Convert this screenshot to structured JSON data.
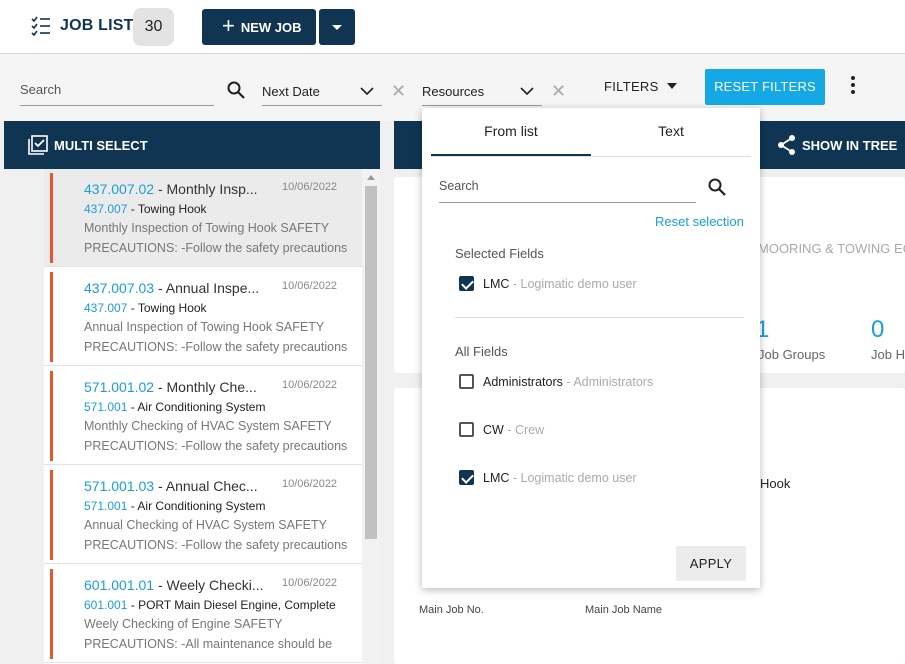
{
  "header": {
    "title": "JOB LIST",
    "count": "30",
    "new_job_label": "NEW JOB"
  },
  "filters": {
    "search_placeholder": "Search",
    "date_select": "Next Date",
    "resources_select": "Resources",
    "filters_label": "FILTERS",
    "reset_label": "RESET FILTERS"
  },
  "left_panel": {
    "multi_select_label": "MULTI SELECT",
    "jobs": [
      {
        "code": "437.007.02",
        "name": "- Monthly Insp...",
        "date": "10/06/2022",
        "parent_code": "437.007",
        "parent_name": "- Towing Hook",
        "desc1": "Monthly Inspection of Towing Hook SAFETY",
        "desc2": "PRECAUTIONS: -Follow the safety precautions"
      },
      {
        "code": "437.007.03",
        "name": "- Annual Inspe...",
        "date": "10/06/2022",
        "parent_code": "437.007",
        "parent_name": "- Towing Hook",
        "desc1": "Annual Inspection of Towing Hook SAFETY",
        "desc2": "PRECAUTIONS: -Follow the safety precautions"
      },
      {
        "code": "571.001.02",
        "name": "- Monthly Che...",
        "date": "10/06/2022",
        "parent_code": "571.001",
        "parent_name": "- Air Conditioning System",
        "desc1": "Monthly Checking of HVAC System SAFETY",
        "desc2": "PRECAUTIONS: -Follow the safety precautions"
      },
      {
        "code": "571.001.03",
        "name": "- Annual Chec...",
        "date": "10/06/2022",
        "parent_code": "571.001",
        "parent_name": "- Air Conditioning System",
        "desc1": "Annual Checking of HVAC System SAFETY",
        "desc2": "PRECAUTIONS: -Follow the safety precautions"
      },
      {
        "code": "601.001.01",
        "name": "- Weely Checki...",
        "date": "10/06/2022",
        "parent_code": "601.001",
        "parent_name": "- PORT Main Diesel Engine, Complete",
        "desc1": "Weely Checking of Engine SAFETY",
        "desc2": "PRECAUTIONS: -All maintenance should be"
      }
    ]
  },
  "right_panel": {
    "show_in_tree_label": "SHOW IN TREE",
    "mooring_text": "MOORING & TOWING EQU",
    "job_groups_value": "1",
    "job_groups_label": "Job Groups",
    "job_h_value": "0",
    "job_h_label": "Job H",
    "hook_text": "Hook",
    "main_job_no_label": "Main Job No.",
    "main_job_name_label": "Main Job Name"
  },
  "dropdown": {
    "tab_from_list": "From list",
    "tab_text": "Text",
    "search_placeholder": "Search",
    "reset_selection": "Reset selection",
    "selected_heading": "Selected Fields",
    "selected": [
      {
        "code": "LMC",
        "desc": "- Logimatic demo user",
        "checked": true
      }
    ],
    "all_heading": "All Fields",
    "all": [
      {
        "code": "Administrators",
        "desc": "- Administrators",
        "checked": false
      },
      {
        "code": "CW",
        "desc": "- Crew",
        "checked": false
      },
      {
        "code": "LMC",
        "desc": "- Logimatic demo user",
        "checked": true
      }
    ],
    "apply_label": "APPLY"
  },
  "colors": {
    "navy": "#0f3552",
    "accent_blue": "#14a9e4",
    "link_blue": "#1a9ed8",
    "status_bar": "#e8562b"
  }
}
